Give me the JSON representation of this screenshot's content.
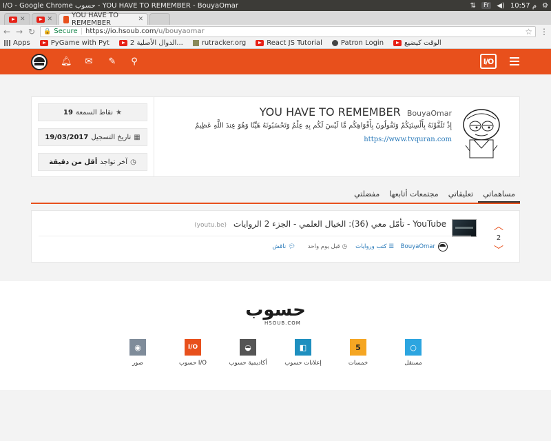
{
  "os": {
    "window_title": "I/O - Google Chrome حسوب - YOU HAVE TO REMEMBER - BouyaOmar",
    "keyboard_layout": "Fr",
    "time": "10:57 م"
  },
  "browser": {
    "tabs": [
      {
        "label": "",
        "icon": "youtube-icon"
      },
      {
        "label": "",
        "icon": "youtube-icon"
      },
      {
        "label": "YOU HAVE TO REMEMBER",
        "icon": "io-favicon",
        "active": true
      },
      {
        "label": "",
        "icon": "",
        "new": true
      }
    ],
    "secure_label": "Secure",
    "url_host": "https://io.hsoub.com",
    "url_path": "/u/bouyaomar",
    "bookmarks": [
      {
        "label": "Apps",
        "icon": "apps-grid-icon"
      },
      {
        "label": "PyGame with Pyt",
        "icon": "youtube-icon"
      },
      {
        "label": "الدوال الأصلية 2...",
        "icon": "youtube-icon"
      },
      {
        "label": "rutracker.org",
        "icon": "rutracker-icon"
      },
      {
        "label": "React JS Tutorial",
        "icon": "youtube-icon"
      },
      {
        "label": "Patron Login",
        "icon": "patron-icon"
      },
      {
        "label": "الوقت كيضيع",
        "icon": "youtube-icon"
      }
    ]
  },
  "site": {
    "brand_color": "#e8501c",
    "logo_text": "I/O",
    "header_icons": [
      "bell-icon",
      "envelope-icon",
      "pencil-icon",
      "search-icon"
    ]
  },
  "profile": {
    "name": "YOU HAVE TO REMEMBER",
    "handle": "BouyaOmar",
    "bio": "إِذْ تَلَقَّوْنَهُ بِأَلْسِنَتِكُمْ وَتَقُولُونَ بِأَفْوَاهِكُم مَّا لَيْسَ لَكُم بِهِ عِلْمٌ وَتَحْسَبُونَهُ هَيِّنًا وَهُوَ عِندَ اللَّهِ عَظِيمٌ",
    "link": "https://www.tvquran.com",
    "stats": [
      {
        "label": "نقاط السمعة",
        "value": "19",
        "icon": "star-icon"
      },
      {
        "label": "تاريخ التسجيل",
        "value": "19/03/2017",
        "icon": "calendar-icon"
      },
      {
        "label": "آخر تواجد",
        "value": "أقل من دقيقة",
        "icon": "clock-icon"
      }
    ]
  },
  "profile_tabs": [
    "مساهماتي",
    "تعليقاتي",
    "مجتمعات أتابعها",
    "مفضلتي"
  ],
  "post": {
    "votes": "2",
    "title": "YouTube - تأمّل معي (36): الخيال العلمي - الجزء 2 الروايات",
    "domain": "(youtu.be)",
    "author": "BouyaOmar",
    "community": "كتب وروايات",
    "time": "قبل يوم واحد",
    "discuss": "ناقش"
  },
  "footer": {
    "logo_text": "حسوب",
    "logo_sub": "HSOUB.COM",
    "products": [
      {
        "label": "مستقل",
        "color": "#2ca5e0",
        "glyph": "○"
      },
      {
        "label": "خمسات",
        "color": "#f5a623",
        "glyph": "5"
      },
      {
        "label": "إعلانات حسوب",
        "color": "#1e8fbf",
        "glyph": "◧"
      },
      {
        "label": "أكاديمية حسوب",
        "color": "#555555",
        "glyph": "◒"
      },
      {
        "label": "حسوب I/O",
        "color": "#e8501c",
        "glyph": "I/O"
      },
      {
        "label": "صور",
        "color": "#7f8c9a",
        "glyph": "◉"
      }
    ]
  }
}
